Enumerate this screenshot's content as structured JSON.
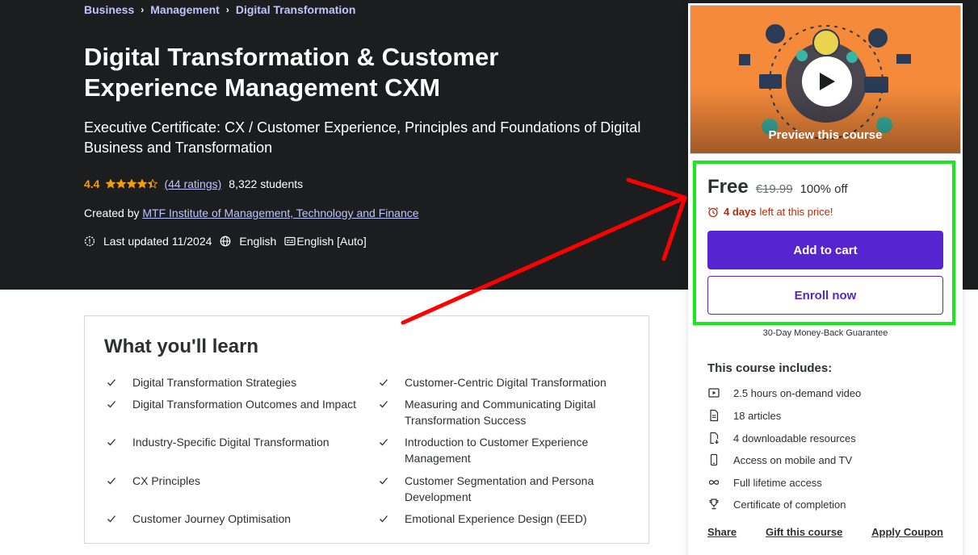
{
  "colors": {
    "accent": "#5624d0",
    "hero_bg": "#1c1d1f",
    "rating": "#f69c08",
    "urgency": "#b32d0f",
    "highlight": "#19e81d",
    "annotation_arrow": "#ff0000"
  },
  "breadcrumb": [
    "Business",
    "Management",
    "Digital Transformation"
  ],
  "course": {
    "title": "Digital Transformation & Customer Experience Management CXM",
    "subtitle": "Executive Certificate: CX / Customer Experience, Principles and Foundations of Digital Business and Transformation",
    "rating": "4.4",
    "rating_stars": 4.4,
    "ratings_count": "(44 ratings)",
    "students": "8,322 students",
    "created_by_label": "Created by",
    "instructor": "MTF Institute of Management, Technology and Finance",
    "last_updated": "Last updated 11/2024",
    "language": "English",
    "captions": "English [Auto]"
  },
  "learn": {
    "title": "What you'll learn",
    "items": [
      "Digital Transformation Strategies",
      "Customer-Centric Digital Transformation",
      "Digital Transformation Outcomes and Impact",
      "Measuring and Communicating Digital Transformation Success",
      "Industry-Specific Digital Transformation",
      "Introduction to Customer Experience Management",
      "CX Principles",
      "Customer Segmentation and Persona Development",
      "Customer Journey Optimisation",
      "Emotional Experience Design (EED)"
    ]
  },
  "sidebar": {
    "preview_label": "Preview this course",
    "price_now": "Free",
    "price_old": "€19.99",
    "discount": "100% off",
    "timer_bold": "4 days",
    "timer_rest": "left at this price!",
    "add_to_cart": "Add to cart",
    "enroll_now": "Enroll now",
    "guarantee": "30-Day Money-Back Guarantee",
    "includes_title": "This course includes:",
    "includes": [
      {
        "icon": "video-icon",
        "label": "2.5 hours on-demand video"
      },
      {
        "icon": "article-icon",
        "label": "18 articles"
      },
      {
        "icon": "download-file-icon",
        "label": "4 downloadable resources"
      },
      {
        "icon": "mobile-icon",
        "label": "Access on mobile and TV"
      },
      {
        "icon": "infinity-icon",
        "label": "Full lifetime access"
      },
      {
        "icon": "trophy-icon",
        "label": "Certificate of completion"
      }
    ],
    "links": [
      "Share",
      "Gift this course",
      "Apply Coupon"
    ]
  }
}
